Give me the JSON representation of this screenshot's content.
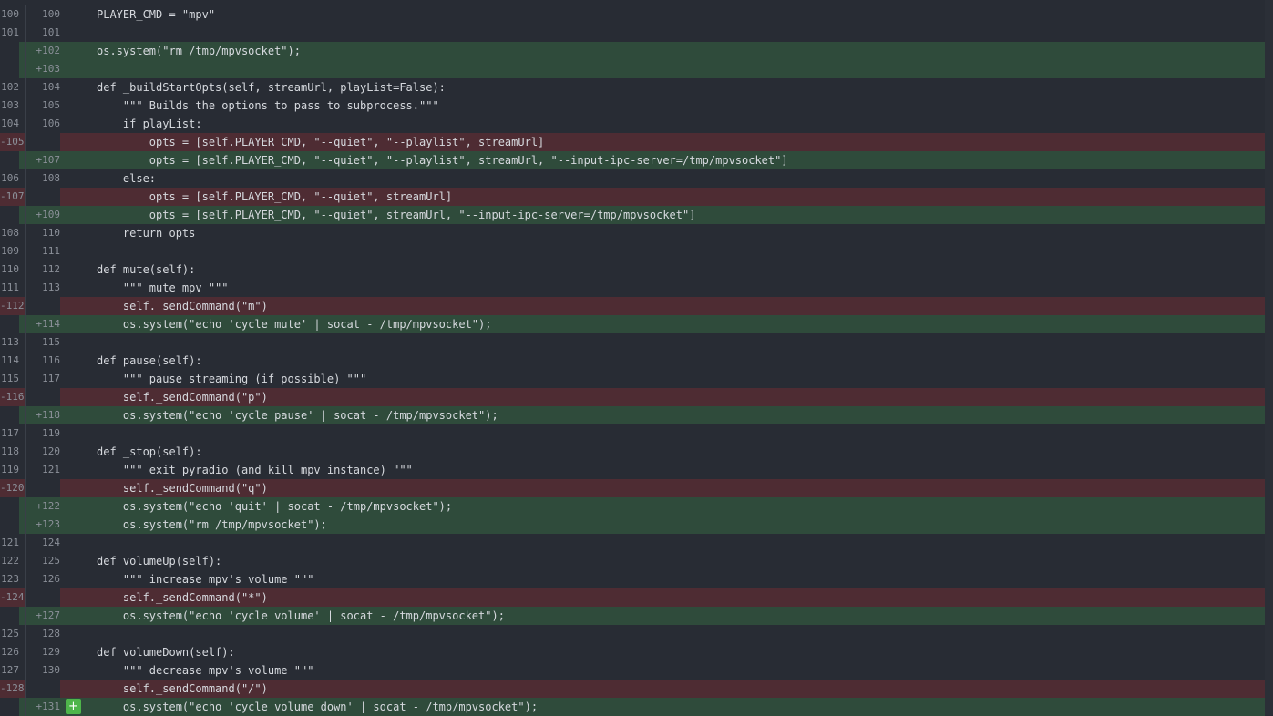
{
  "colors": {
    "background": "#282c34",
    "added_line": "#2f4b3b",
    "removed_line": "#4e2c33",
    "add_comment_button": "#4eb54a"
  },
  "add_comment_icon": "plus-icon",
  "add_comment_symbol": "+",
  "lines": [
    {
      "type": "ctx",
      "old": "100",
      "new": "100",
      "code": "PLAYER_CMD = \"mpv\""
    },
    {
      "type": "ctx",
      "old": "101",
      "new": "101",
      "code": ""
    },
    {
      "type": "add",
      "old": "",
      "new": "+102",
      "code": "os.system(\"rm /tmp/mpvsocket\");"
    },
    {
      "type": "add",
      "old": "",
      "new": "+103",
      "code": ""
    },
    {
      "type": "ctx",
      "old": "102",
      "new": "104",
      "code": "def _buildStartOpts(self, streamUrl, playList=False):"
    },
    {
      "type": "ctx",
      "old": "103",
      "new": "105",
      "code": "    \"\"\" Builds the options to pass to subprocess.\"\"\""
    },
    {
      "type": "ctx",
      "old": "104",
      "new": "106",
      "code": "    if playList:"
    },
    {
      "type": "del",
      "old": "-105",
      "new": "",
      "code": "        opts = [self.PLAYER_CMD, \"--quiet\", \"--playlist\", streamUrl]"
    },
    {
      "type": "add",
      "old": "",
      "new": "+107",
      "code": "        opts = [self.PLAYER_CMD, \"--quiet\", \"--playlist\", streamUrl, \"--input-ipc-server=/tmp/mpvsocket\"]"
    },
    {
      "type": "ctx",
      "old": "106",
      "new": "108",
      "code": "    else:"
    },
    {
      "type": "del",
      "old": "-107",
      "new": "",
      "code": "        opts = [self.PLAYER_CMD, \"--quiet\", streamUrl]"
    },
    {
      "type": "add",
      "old": "",
      "new": "+109",
      "code": "        opts = [self.PLAYER_CMD, \"--quiet\", streamUrl, \"--input-ipc-server=/tmp/mpvsocket\"]"
    },
    {
      "type": "ctx",
      "old": "108",
      "new": "110",
      "code": "    return opts"
    },
    {
      "type": "ctx",
      "old": "109",
      "new": "111",
      "code": ""
    },
    {
      "type": "ctx",
      "old": "110",
      "new": "112",
      "code": "def mute(self):"
    },
    {
      "type": "ctx",
      "old": "111",
      "new": "113",
      "code": "    \"\"\" mute mpv \"\"\""
    },
    {
      "type": "del",
      "old": "-112",
      "new": "",
      "code": "    self._sendCommand(\"m\")"
    },
    {
      "type": "add",
      "old": "",
      "new": "+114",
      "code": "    os.system(\"echo 'cycle mute' | socat - /tmp/mpvsocket\");"
    },
    {
      "type": "ctx",
      "old": "113",
      "new": "115",
      "code": ""
    },
    {
      "type": "ctx",
      "old": "114",
      "new": "116",
      "code": "def pause(self):"
    },
    {
      "type": "ctx",
      "old": "115",
      "new": "117",
      "code": "    \"\"\" pause streaming (if possible) \"\"\""
    },
    {
      "type": "del",
      "old": "-116",
      "new": "",
      "code": "    self._sendCommand(\"p\")"
    },
    {
      "type": "add",
      "old": "",
      "new": "+118",
      "code": "    os.system(\"echo 'cycle pause' | socat - /tmp/mpvsocket\");"
    },
    {
      "type": "ctx",
      "old": "117",
      "new": "119",
      "code": ""
    },
    {
      "type": "ctx",
      "old": "118",
      "new": "120",
      "code": "def _stop(self):"
    },
    {
      "type": "ctx",
      "old": "119",
      "new": "121",
      "code": "    \"\"\" exit pyradio (and kill mpv instance) \"\"\""
    },
    {
      "type": "del",
      "old": "-120",
      "new": "",
      "code": "    self._sendCommand(\"q\")"
    },
    {
      "type": "add",
      "old": "",
      "new": "+122",
      "code": "    os.system(\"echo 'quit' | socat - /tmp/mpvsocket\");"
    },
    {
      "type": "add",
      "old": "",
      "new": "+123",
      "code": "    os.system(\"rm /tmp/mpvsocket\");"
    },
    {
      "type": "ctx",
      "old": "121",
      "new": "124",
      "code": ""
    },
    {
      "type": "ctx",
      "old": "122",
      "new": "125",
      "code": "def volumeUp(self):"
    },
    {
      "type": "ctx",
      "old": "123",
      "new": "126",
      "code": "    \"\"\" increase mpv's volume \"\"\""
    },
    {
      "type": "del",
      "old": "-124",
      "new": "",
      "code": "    self._sendCommand(\"*\")"
    },
    {
      "type": "add",
      "old": "",
      "new": "+127",
      "code": "    os.system(\"echo 'cycle volume' | socat - /tmp/mpvsocket\");"
    },
    {
      "type": "ctx",
      "old": "125",
      "new": "128",
      "code": ""
    },
    {
      "type": "ctx",
      "old": "126",
      "new": "129",
      "code": "def volumeDown(self):"
    },
    {
      "type": "ctx",
      "old": "127",
      "new": "130",
      "code": "    \"\"\" decrease mpv's volume \"\"\""
    },
    {
      "type": "del",
      "old": "-128",
      "new": "",
      "code": "    self._sendCommand(\"/\")"
    },
    {
      "type": "add",
      "old": "",
      "new": "+131",
      "code": "    os.system(\"echo 'cycle volume down' | socat - /tmp/mpvsocket\");",
      "comment_button": true
    }
  ]
}
